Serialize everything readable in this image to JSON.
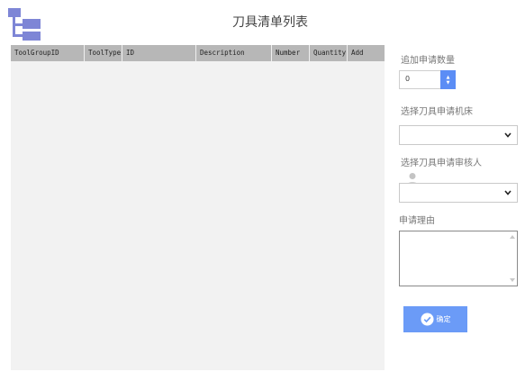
{
  "header": {
    "title": "刀具清单列表",
    "logo_icon": "hierarchy-icon"
  },
  "table": {
    "columns": [
      "ToolGroupID",
      "ToolType",
      "ID",
      "Description",
      "Number",
      "Quantity",
      "Add"
    ],
    "rows": []
  },
  "form": {
    "quantity_label": "追加申请数量",
    "quantity_value": "0",
    "machine_label": "选择刀具申请机床",
    "machine_value": "",
    "reviewer_label": "选择刀具申请审核人",
    "reviewer_value": "",
    "reason_label": "申请理由",
    "reason_value": "",
    "confirm_label": "确定"
  },
  "colors": {
    "accent": "#5b8df5",
    "button": "#6b9bf7",
    "logo": "#7e86d6",
    "table_header": "#b7b7b7",
    "table_body": "#f2f2f2"
  }
}
